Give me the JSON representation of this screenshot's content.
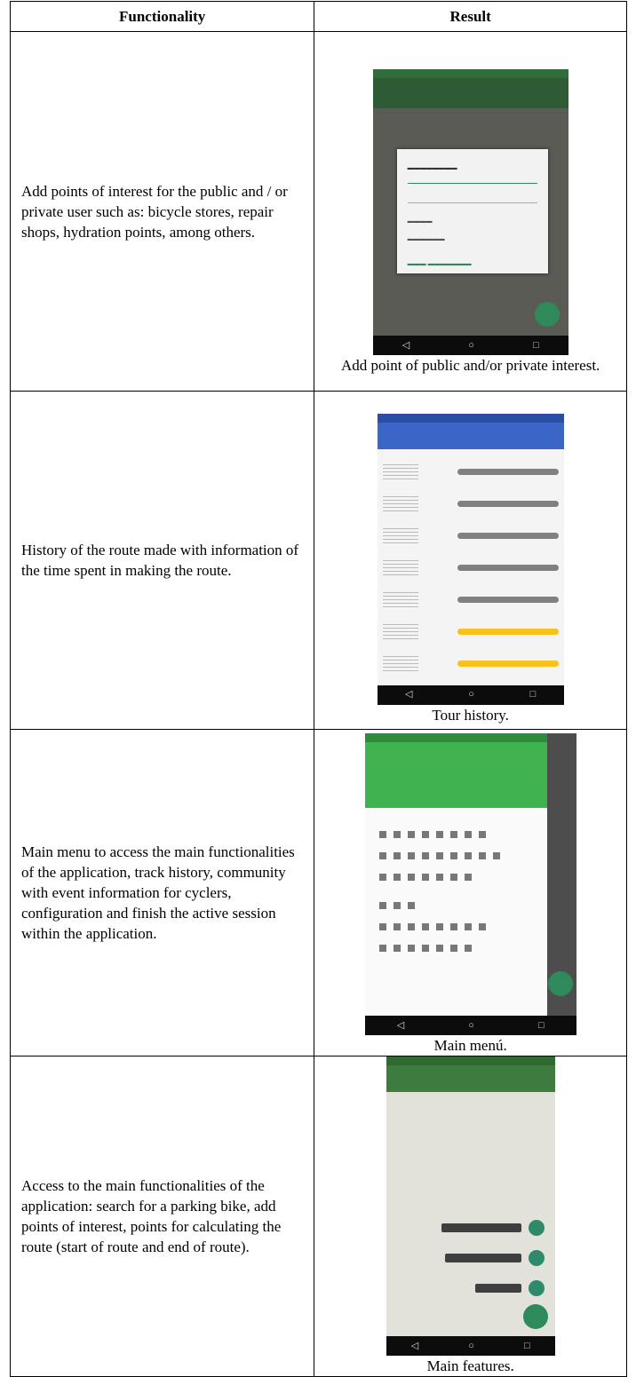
{
  "header": {
    "col1": "Functionality",
    "col2": "Result"
  },
  "rows": [
    {
      "description": "Add points of interest for the public and / or private user such as: bicycle stores, repair shops, hydration points, among others.",
      "caption": "Add point of public and/or private interest."
    },
    {
      "description": "History of the route made with information of the time spent in making the route.",
      "caption": "Tour history."
    },
    {
      "description": "Main menu to access the main functionalities of the application, track history, community with event information for cyclers, configuration and finish the active session within the application.",
      "caption": "Main menú."
    },
    {
      "description": "Access to the main functionalities of the application: search for a parking bike, add points of interest, points for calculating the route (start of route and end of route).",
      "caption": "Main features."
    }
  ],
  "colors": {
    "history_gray": "#808080",
    "history_yellow": "#f7c21b",
    "drawer_green": "#3fb34f",
    "fab_green": "#2e8a5a"
  },
  "icons": [
    "back-icon",
    "home-icon",
    "recents-icon",
    "menu-icon",
    "add-fab-icon",
    "search-icon",
    "pin-icon",
    "bike-icon"
  ]
}
